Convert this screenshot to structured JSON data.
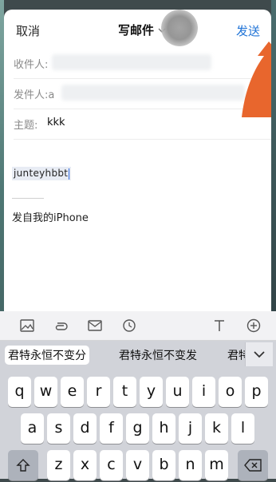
{
  "nav": {
    "cancel": "取消",
    "title": "写邮件",
    "send": "发送"
  },
  "fields": {
    "to_label": "收件人:",
    "from_label": "发件人:a",
    "subject_label": "主题:",
    "subject_value": "kkk"
  },
  "body": {
    "text": "junteyhbbt",
    "signature": "发自我的iPhone"
  },
  "candidates": [
    "君特永恒不变分",
    "君特永恒不变发",
    "君特"
  ],
  "keyboard": {
    "row1": [
      "q",
      "w",
      "e",
      "r",
      "t",
      "y",
      "u",
      "i",
      "o",
      "p"
    ],
    "row2": [
      "a",
      "s",
      "d",
      "f",
      "g",
      "h",
      "j",
      "k",
      "l"
    ],
    "row3": [
      "z",
      "x",
      "c",
      "v",
      "b",
      "n",
      "m"
    ]
  },
  "colors": {
    "accent": "#1f73d6",
    "arrow": "#e8662d"
  }
}
